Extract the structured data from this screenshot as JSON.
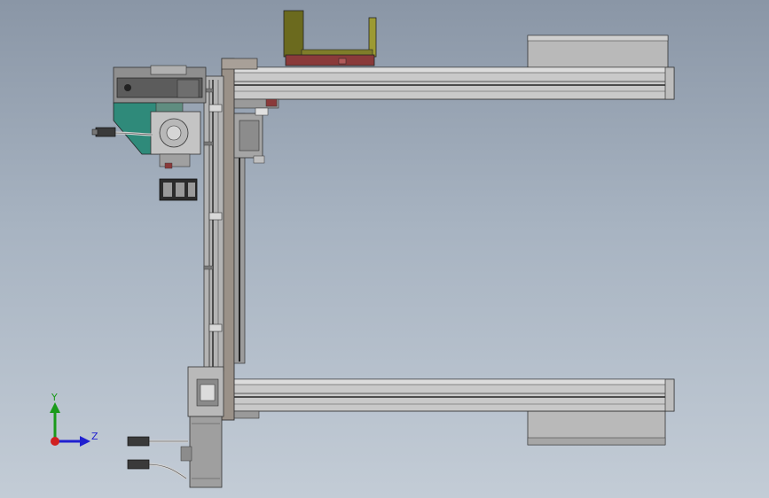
{
  "viewport": {
    "background_top": "#8a96a6",
    "background_bottom": "#c3ccd6"
  },
  "triad": {
    "y_label": "Y",
    "z_label": "Z",
    "y_color": "#1a9a1a",
    "z_color": "#2020d0",
    "x_color": "#d02020"
  },
  "colors": {
    "rail": "#c9c9c9",
    "rail_dark": "#8c8c8c",
    "bracket_olive": "#6b6a1e",
    "base_red": "#8a3a3a",
    "guard_teal": "#2f8a7a",
    "cable": "#d0d0d0"
  }
}
